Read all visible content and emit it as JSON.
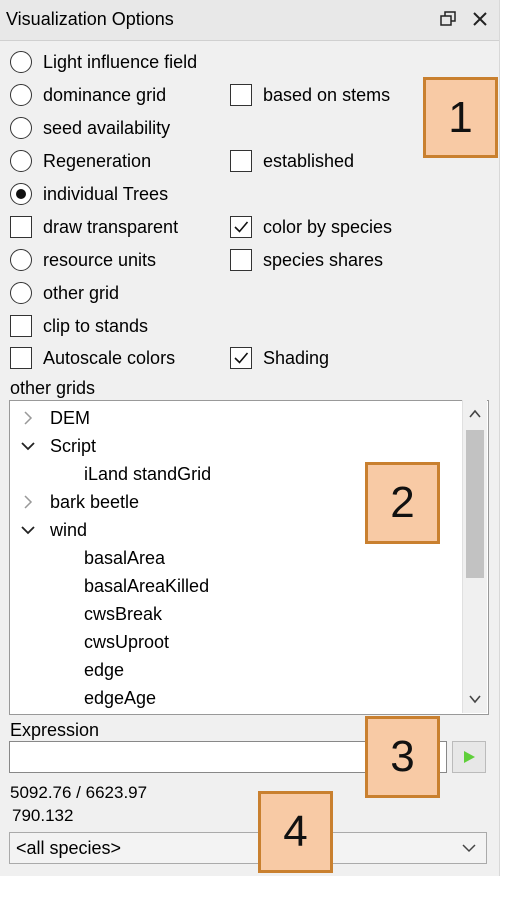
{
  "window": {
    "title": "Visualization Options",
    "float_icon": "restore-window-icon",
    "close_icon": "close-icon"
  },
  "options": {
    "light_influence_field": "Light influence field",
    "dominance_grid": "dominance grid",
    "based_on_stems": "based on stems",
    "seed_availability": "seed availability",
    "regeneration": "Regeneration",
    "established": "established",
    "individual_trees": "individual Trees",
    "draw_transparent": "draw transparent",
    "color_by_species": "color by species",
    "resource_units": "resource units",
    "species_shares": "species shares",
    "other_grid": "other grid",
    "clip_to_stands": "clip to stands",
    "autoscale_colors": "Autoscale colors",
    "shading": "Shading"
  },
  "other_grids": {
    "label": "other grids",
    "items": [
      "DEM",
      "Script",
      "iLand standGrid",
      "bark beetle",
      "wind",
      "basalArea",
      "basalAreaKilled",
      "cwsBreak",
      "cwsUproot",
      "edge",
      "edgeAge"
    ]
  },
  "expression": {
    "label": "Expression",
    "value": ""
  },
  "status": {
    "coords": "5092.76 / 6623.97",
    "value": "790.132"
  },
  "species_select": {
    "selected": "<all species>"
  },
  "badges": [
    "1",
    "2",
    "3",
    "4"
  ],
  "colors": {
    "badge_fill": "#f8caa5",
    "badge_border": "#c9802f",
    "run_icon": "#5fcf3a"
  }
}
